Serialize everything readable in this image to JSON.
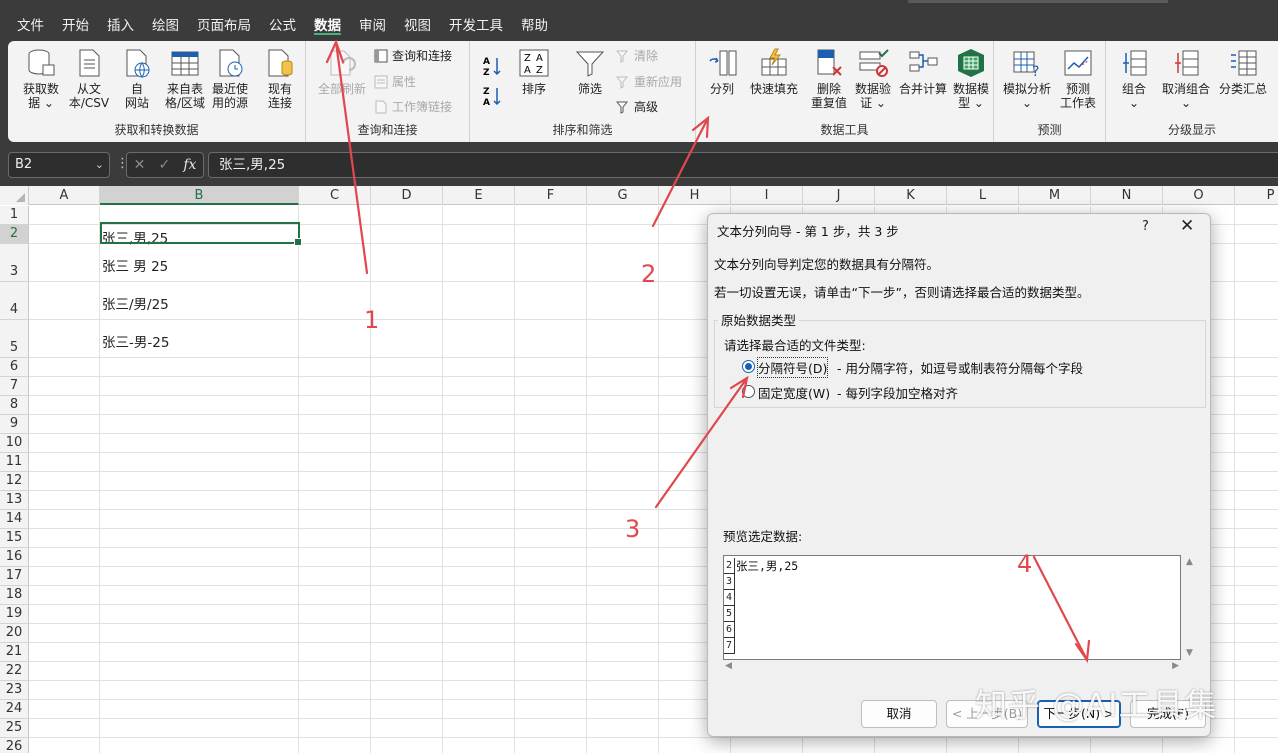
{
  "menu": {
    "tabs": [
      "文件",
      "开始",
      "插入",
      "绘图",
      "页面布局",
      "公式",
      "数据",
      "审阅",
      "视图",
      "开发工具",
      "帮助"
    ],
    "active": "数据"
  },
  "ribbon": {
    "groups": {
      "get_transform": "获取和转换数据",
      "queries": "查询和连接",
      "sort_filter": "排序和筛选",
      "data_tools": "数据工具",
      "forecast": "预测",
      "outline": "分级显示"
    },
    "buttons": {
      "get_data_1": "获取数",
      "get_data_2": "据 ⌄",
      "from_csv_1": "从文",
      "from_csv_2": "本/CSV",
      "from_web_1": "自",
      "from_web_2": "网站",
      "from_table_1": "来自表",
      "from_table_2": "格/区域",
      "recent_1": "最近使",
      "recent_2": "用的源",
      "existing_1": "现有",
      "existing_2": "连接",
      "refresh_all_1": "全部刷新",
      "queries_connections": "查询和连接",
      "properties": "属性",
      "workbook_links": "工作簿链接",
      "sort": "排序",
      "filter": "筛选",
      "clear": "清除",
      "reapply": "重新应用",
      "advanced": "高级",
      "text_to_columns": "分列",
      "flash_fill": "快速填充",
      "remove_dup_1": "删除",
      "remove_dup_2": "重复值",
      "validation_1": "数据验",
      "validation_2": "证 ⌄",
      "consolidate": "合并计算",
      "data_model_1": "数据模",
      "data_model_2": "型 ⌄",
      "whatif_1": "模拟分析",
      "whatif_2": "⌄",
      "forecast_1": "预测",
      "forecast_2": "工作表",
      "group_1": "组合",
      "group_2": "⌄",
      "ungroup_1": "取消组合",
      "ungroup_2": "⌄",
      "subtotal": "分类汇总"
    }
  },
  "formula_bar": {
    "name_box": "B2",
    "formula": "张三,男,25"
  },
  "grid": {
    "columns": [
      "A",
      "B",
      "C",
      "D",
      "E",
      "F",
      "G",
      "H",
      "I",
      "J",
      "K",
      "L",
      "M",
      "N",
      "O",
      "P"
    ],
    "rows": [
      "1",
      "2",
      "3",
      "4",
      "5",
      "6",
      "7",
      "8",
      "9",
      "10",
      "11",
      "12",
      "13",
      "14",
      "15",
      "16",
      "17",
      "18",
      "19",
      "20",
      "21",
      "22",
      "23",
      "24",
      "25",
      "26"
    ],
    "cells": [
      "张三,男,25",
      "张三 男 25",
      "张三/男/25",
      "张三-男-25"
    ]
  },
  "dialog": {
    "title": "文本分列向导 - 第 1 步，共 3 步",
    "help": "?",
    "close": "✕",
    "intro1": "文本分列向导判定您的数据具有分隔符。",
    "intro2": "若一切设置无误，请单击“下一步”，否则请选择最合适的数据类型。",
    "frame_label": "原始数据类型",
    "choose_label": "请选择最合适的文件类型:",
    "opt1_label": "分隔符号(D)",
    "opt1_desc": "- 用分隔字符，如逗号或制表符分隔每个字段",
    "opt2_label": "固定宽度(W)",
    "opt2_desc": "- 每列字段加空格对齐",
    "preview_label": "预览选定数据:",
    "preview_rows": [
      "2",
      "3",
      "4",
      "5",
      "6",
      "7"
    ],
    "preview_text": "张三,男,25",
    "btn_cancel": "取消",
    "btn_back": "< 上一步(B)",
    "btn_next": "下一步(N) >",
    "btn_finish": "完成(F)"
  },
  "annotations": {
    "labels": [
      "1",
      "2",
      "3",
      "4"
    ],
    "color": "#e0484d"
  },
  "watermark": "知乎 @AI工具集",
  "colors": {
    "accent_green": "#217346",
    "dark_bg": "#3b3b3b",
    "ribbon_bg": "#f3f3f3",
    "radio_blue": "#1a5fb4"
  }
}
